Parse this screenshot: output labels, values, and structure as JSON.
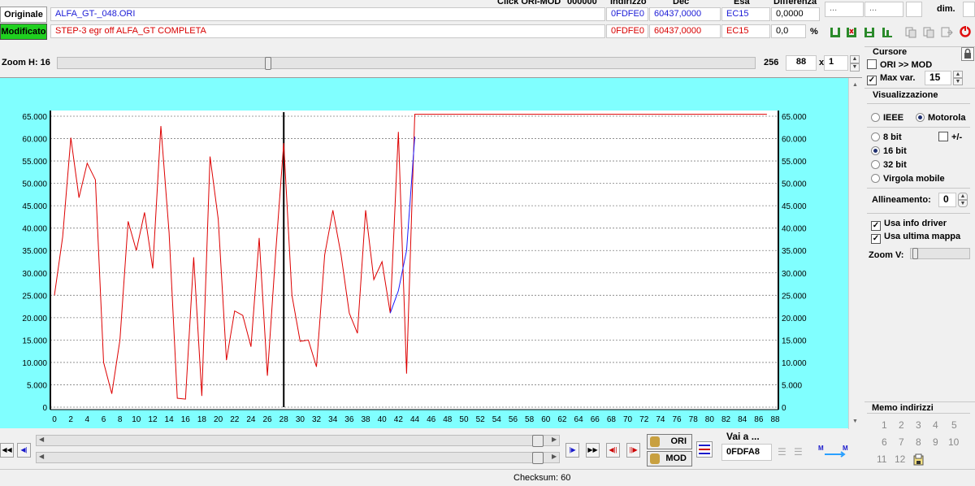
{
  "headers": {
    "clicchi": "Click ORI-MOD",
    "clicchi_value": "000000",
    "indirizzo": "Indirizzo",
    "dec": "Dec",
    "esa": "Esa",
    "differenza": "Differenza",
    "dim": "dim."
  },
  "ori": {
    "label": "Originale",
    "filename": "ALFA_GT-_048.ORI",
    "address": "0FDFE0",
    "dec": "60437,0000",
    "hex": "EC15",
    "diff": "0,0000"
  },
  "mod": {
    "label": "Modificato",
    "filename": "STEP-3 egr off ALFA_GT COMPLETA",
    "address": "0FDFE0",
    "dec": "60437,0000",
    "hex": "EC15",
    "diff": "0,0",
    "diff_unit": "%"
  },
  "top_right": {
    "box1": "...",
    "box2": "..."
  },
  "zoom": {
    "label": "Zoom H: 16",
    "max": "256",
    "value": "88",
    "x_label": "x",
    "multiplier": "1"
  },
  "cursor_panel": {
    "title": "Cursore",
    "ori_mod": "ORI >> MOD",
    "max_var": "Max var.",
    "max_var_value": "15"
  },
  "vis_panel": {
    "title": "Visualizzazione",
    "ieee": "IEEE",
    "motorola": "Motorola",
    "bit8": "8 bit",
    "plusminus": "+/-",
    "bit16": "16 bit",
    "bit32": "32 bit",
    "float": "Virgola mobile",
    "align_label": "Allineamento:",
    "align_value": "0",
    "usa_info": "Usa info driver",
    "usa_ultima": "Usa ultima mappa",
    "zoom_v": "Zoom V:"
  },
  "memo": {
    "title": "Memo indirizzi",
    "numbers": [
      "1",
      "2",
      "3",
      "4",
      "5",
      "6",
      "7",
      "8",
      "9",
      "10",
      "11",
      "12"
    ]
  },
  "bottom": {
    "vai_label": "Vai a ...",
    "vai_value": "0FDFA8",
    "ori_btn": "ORI",
    "mod_btn": "MOD",
    "checksum": "Checksum: 60"
  },
  "colors": {
    "plot_bg": "#80ffff",
    "ori_line": "#1a1aff",
    "mod_line": "#dd0000",
    "mod_label_bg": "#1fd01f"
  },
  "chart_data": {
    "type": "line",
    "x": [
      0,
      1,
      2,
      3,
      4,
      5,
      6,
      7,
      8,
      9,
      10,
      11,
      12,
      13,
      14,
      15,
      16,
      17,
      18,
      19,
      20,
      21,
      22,
      23,
      24,
      25,
      26,
      27,
      28,
      29,
      30,
      31,
      32,
      33,
      34,
      35,
      36,
      37,
      38,
      39,
      40,
      41,
      42,
      43,
      44,
      45,
      46,
      47,
      48,
      49,
      50,
      51,
      52,
      53,
      54,
      55,
      56,
      57,
      58,
      59,
      60,
      61,
      62,
      63,
      64,
      65,
      66,
      67,
      68,
      69,
      70,
      71,
      72,
      73,
      74,
      75,
      76,
      77,
      78,
      79,
      80,
      81,
      82,
      83,
      84,
      85,
      86,
      87
    ],
    "xticks": [
      "0",
      "2",
      "4",
      "6",
      "8",
      "10",
      "12",
      "14",
      "16",
      "18",
      "20",
      "22",
      "24",
      "26",
      "28",
      "30",
      "32",
      "34",
      "36",
      "38",
      "40",
      "42",
      "44",
      "46",
      "48",
      "50",
      "52",
      "54",
      "56",
      "58",
      "60",
      "62",
      "64",
      "66",
      "68",
      "70",
      "72",
      "74",
      "76",
      "78",
      "80",
      "82",
      "84",
      "86",
      "88"
    ],
    "ytick_labels": [
      "65.000",
      "60.000",
      "55.000",
      "50.000",
      "45.000",
      "40.000",
      "35.000",
      "30.000",
      "25.000",
      "20.000",
      "15.000",
      "10.000",
      "5.000",
      "0"
    ],
    "ylim": [
      0,
      65000
    ],
    "xlim": [
      0,
      88
    ],
    "cursor_x": 28,
    "grid": true,
    "series": [
      {
        "values": [
          25000,
          38000,
          60200,
          46800,
          54500,
          50800,
          10000,
          3000,
          15000,
          41500,
          35000,
          43500,
          31000,
          62800,
          39000,
          2000,
          1800,
          33500,
          2500,
          56000,
          42000,
          10500,
          21500,
          20500,
          13500,
          37800,
          7000,
          34000,
          59000,
          25000,
          14700,
          15000,
          9000,
          34000,
          44000,
          34000,
          21000,
          16500,
          44000,
          28500,
          32500,
          21000,
          61500,
          7500,
          65437,
          65437,
          65437,
          65437,
          65437,
          65437,
          65437,
          65437,
          65437,
          65437,
          65437,
          65437,
          65437,
          65437,
          65437,
          65437,
          65437,
          65437,
          65437,
          65437,
          65437,
          65437,
          65437,
          65437,
          65437,
          65437,
          65437,
          65437,
          65437,
          65437,
          65437,
          65437,
          65437,
          65437,
          65437,
          65437,
          65437,
          65437,
          65437,
          65437,
          65437,
          65437,
          65437,
          65437
        ]
      },
      {
        "values": [
          null,
          null,
          null,
          null,
          null,
          null,
          null,
          null,
          null,
          null,
          null,
          null,
          null,
          null,
          null,
          null,
          null,
          null,
          null,
          null,
          null,
          null,
          null,
          null,
          null,
          null,
          null,
          null,
          null,
          null,
          null,
          null,
          null,
          null,
          null,
          null,
          null,
          null,
          null,
          null,
          null,
          21000,
          26000,
          35000,
          60437
        ]
      }
    ]
  }
}
